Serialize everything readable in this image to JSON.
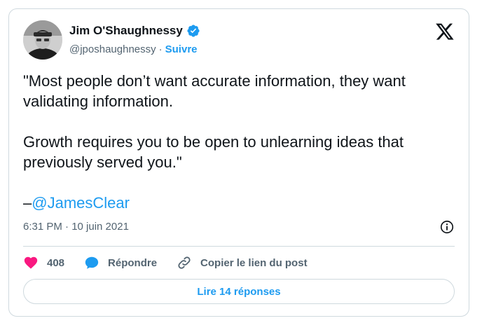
{
  "author": {
    "name": "Jim O'Shaughnessy",
    "handle": "@jposhaughnessy",
    "separator": "·",
    "follow_label": "Suivre",
    "verified": true
  },
  "tweet": {
    "text": "\"Most people don’t want accurate information, they want validating information.\n\nGrowth requires you to be open to unlearning ideas that previously served you.\"\n\n–",
    "mention": "@JamesClear",
    "timestamp": "6:31 PM · 10 juin 2021"
  },
  "actions": {
    "likes_count": "408",
    "reply_label": "Répondre",
    "copy_link_label": "Copier le lien du post"
  },
  "read_replies_label": "Lire 14 réponses",
  "icons": {
    "like": "heart-icon",
    "reply": "speech-bubble-icon",
    "copy": "link-icon",
    "info": "info-icon",
    "brand": "x-logo-icon",
    "verified": "verified-badge-icon"
  },
  "colors": {
    "accent": "#1d9bf0",
    "like": "#f91880",
    "text": "#0f1419",
    "muted": "#536471",
    "border": "#cfd9de"
  }
}
